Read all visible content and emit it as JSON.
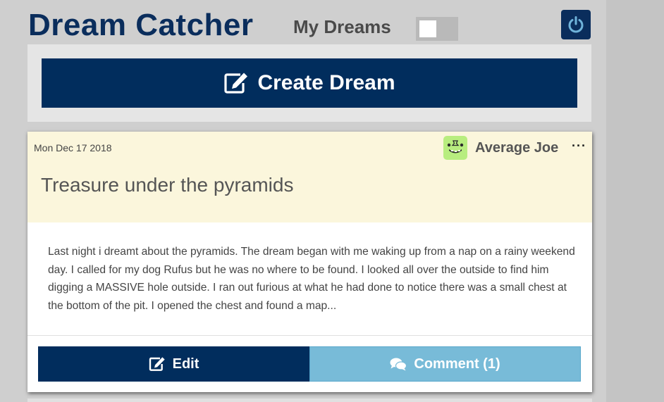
{
  "header": {
    "app_title": "Dream Catcher",
    "my_dreams_label": "My Dreams",
    "power_icon": "power-icon",
    "toggle_state": "off"
  },
  "create": {
    "label": "Create Dream",
    "icon": "edit-icon"
  },
  "dream": {
    "date": "Mon Dec 17 2018",
    "author": "Average Joe",
    "more_label": "···",
    "title": "Treasure under the pyramids",
    "body": "Last night i dreamt about the pyramids. The dream began with me waking up from a nap on a rainy weekend day. I called for my dog Rufus but he was no where to be found. I looked all over the outside to find him digging a MASSIVE hole outside. I ran out furious at what he had done to notice there was a small chest at the bottom of the pit. I opened the chest and found a map...",
    "edit_label": "Edit",
    "comment_label": "Comment (1)"
  },
  "colors": {
    "primary": "#012d5d",
    "comment": "#78bbd8",
    "card_header": "#fbf6dc",
    "avatar_bg": "#b8ed7f"
  }
}
